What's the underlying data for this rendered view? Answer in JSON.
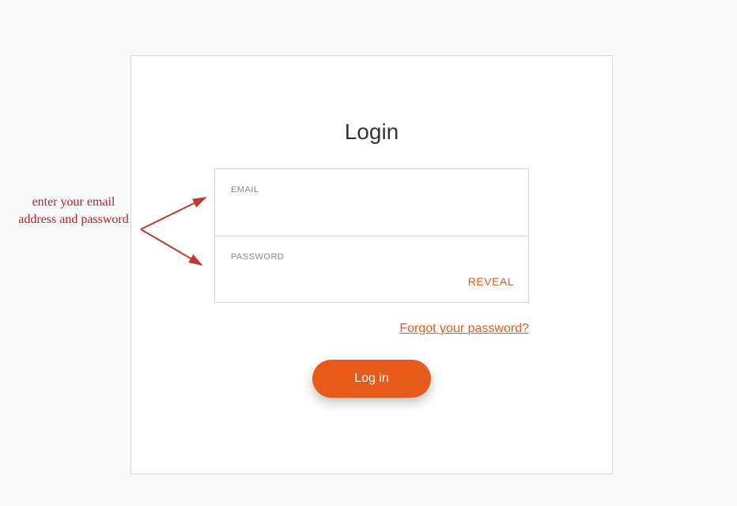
{
  "login": {
    "title": "Login",
    "email_label": "EMAIL",
    "email_value": "",
    "password_label": "PASSWORD",
    "password_value": "",
    "reveal_label": "REVEAL",
    "forgot_label": "Forgot your password?",
    "submit_label": "Log in"
  },
  "annotation": {
    "text": "enter your email address and password"
  }
}
